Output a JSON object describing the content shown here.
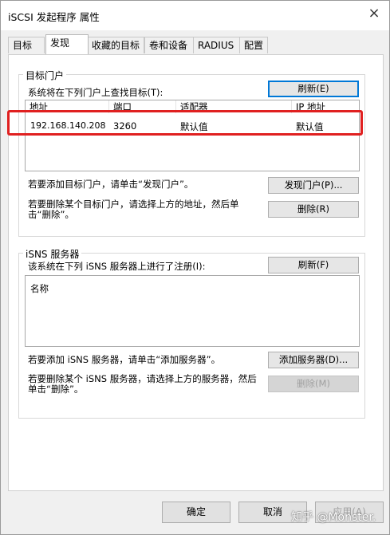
{
  "window": {
    "title": "iSCSI 发起程序 属性",
    "close_glyph": "×"
  },
  "tabs": [
    "目标",
    "发现",
    "收藏的目标",
    "卷和设备",
    "RADIUS",
    "配置"
  ],
  "portals": {
    "group_title": "目标门户",
    "instruction": "系统将在下列门户上查找目标(T):",
    "refresh_button": "刷新(E)",
    "columns": [
      "地址",
      "端口",
      "适配器",
      "IP 地址"
    ],
    "rows": [
      {
        "address": "192.168.140.208",
        "port": "3260",
        "adapter": "默认值",
        "ip": "默认值"
      }
    ],
    "add_hint": "若要添加目标门户，请单击“发现门户”。",
    "discover_button": "发现门户(P)...",
    "remove_hint": "若要删除某个目标门户，请选择上方的地址，然后单击“删除”。",
    "remove_button": "删除(R)"
  },
  "isns": {
    "group_title": "iSNS 服务器",
    "instruction": "该系统在下列 iSNS 服务器上进行了注册(I):",
    "refresh_button": "刷新(F)",
    "column": "名称",
    "add_hint": "若要添加 iSNS 服务器，请单击“添加服务器”。",
    "add_button": "添加服务器(D)...",
    "remove_hint": "若要删除某个 iSNS 服务器，请选择上方的服务器，然后单击“删除”。",
    "remove_button": "删除(M)"
  },
  "footer": {
    "ok": "确定",
    "cancel": "取消",
    "apply": "应用(A)"
  },
  "watermark": "知乎 @Monster.",
  "colors": {
    "highlight": "#e02020",
    "focus": "#0078d7"
  }
}
